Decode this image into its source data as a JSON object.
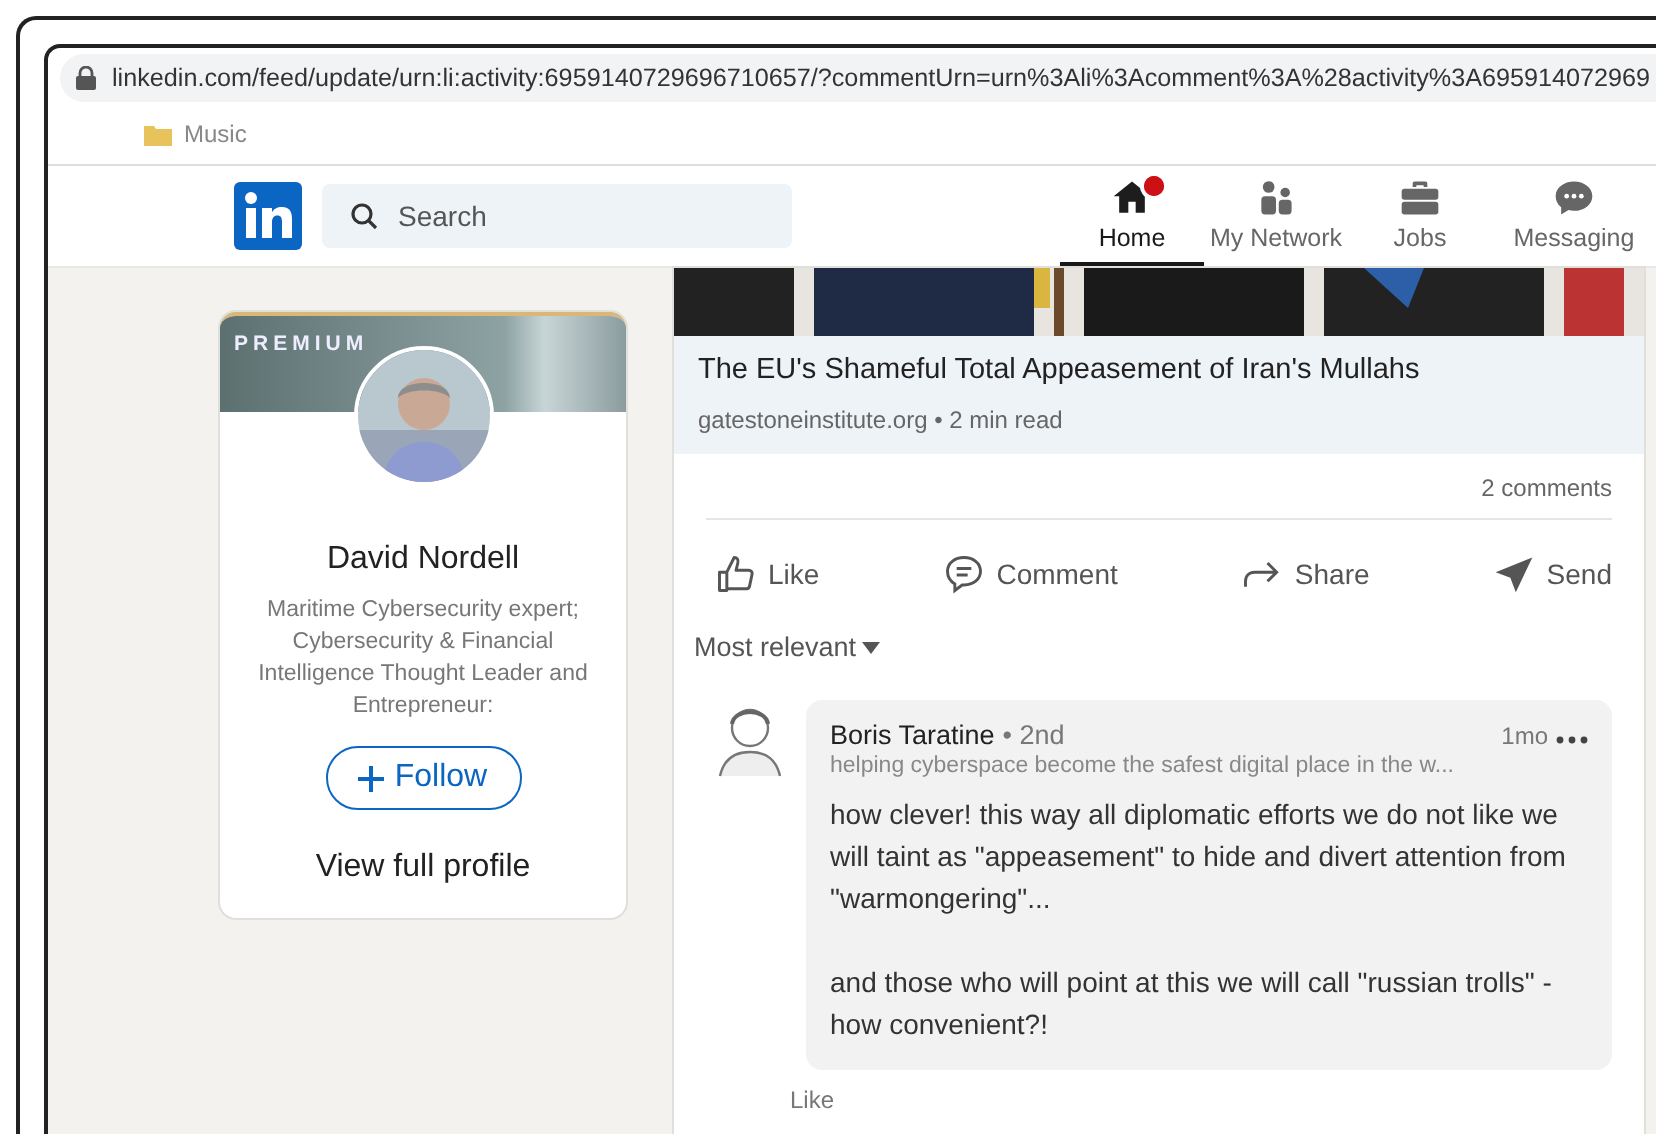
{
  "browser": {
    "url": "linkedin.com/feed/update/urn:li:activity:6959140729696710657/?commentUrn=urn%3Ali%3Acomment%3A%28activity%3A695914072969",
    "bookmarks": [
      {
        "label": "Music"
      }
    ]
  },
  "nav": {
    "search_placeholder": "Search",
    "items": [
      {
        "kind": "home",
        "label": "Home",
        "selected": true,
        "notification": true
      },
      {
        "kind": "network",
        "label": "My Network",
        "selected": false,
        "notification": false
      },
      {
        "kind": "jobs",
        "label": "Jobs",
        "selected": false,
        "notification": false
      },
      {
        "kind": "messaging",
        "label": "Messaging",
        "selected": false,
        "notification": false
      }
    ]
  },
  "profile_card": {
    "badge": "PREMIUM",
    "name": "David Nordell",
    "headline": "Maritime Cybersecurity expert; Cybersecurity & Financial Intelligence Thought Leader and Entrepreneur:",
    "follow_button": "Follow",
    "view_profile": "View full profile"
  },
  "post": {
    "article_title": "The EU's Shameful Total Appeasement of Iran's Mullahs",
    "article_meta": "gatestoneinstitute.org • 2 min read",
    "comments_count": "2 comments",
    "actions": [
      {
        "kind": "like",
        "label": "Like"
      },
      {
        "kind": "comment",
        "label": "Comment"
      },
      {
        "kind": "share",
        "label": "Share"
      },
      {
        "kind": "send",
        "label": "Send"
      }
    ],
    "sort": "Most relevant",
    "comments": [
      {
        "author": "Boris Taratine",
        "degree": "• 2nd",
        "headline": "helping cyberspace become the safest digital place in the w...",
        "time": "1mo",
        "text": "how clever! this way all diplomatic efforts we do not like we will taint as \"appeasement\" to hide and divert attention from \"warmongering\"...\n\nand those who will point at this we will call \"russian trolls\" - how convenient?!",
        "actions": [
          "Like"
        ]
      }
    ]
  }
}
